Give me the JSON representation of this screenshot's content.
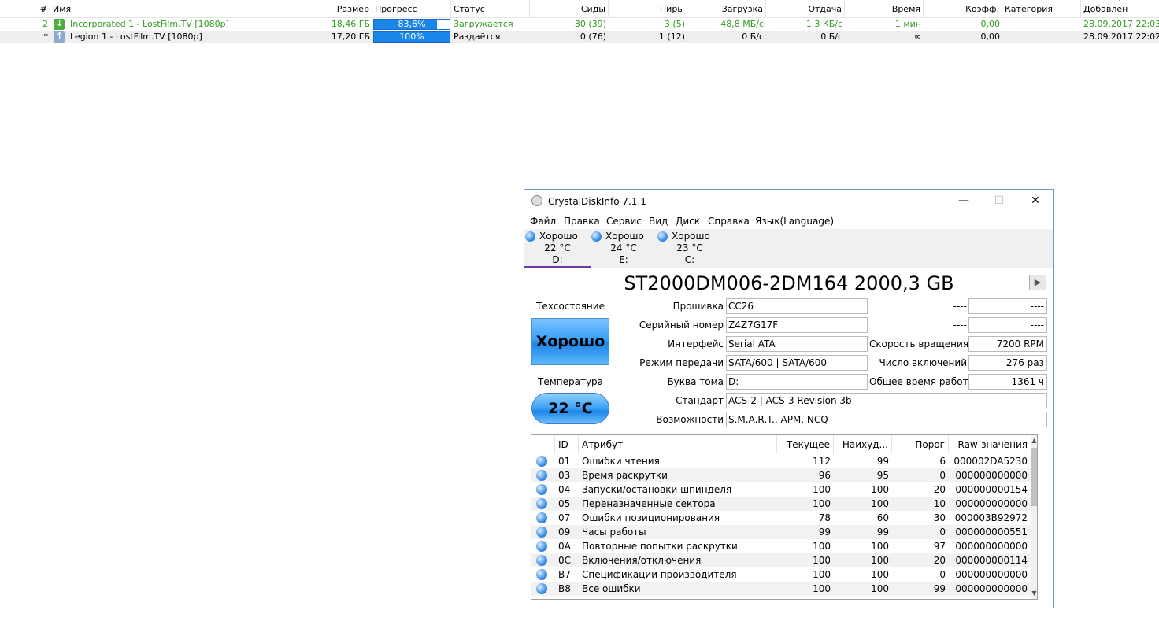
{
  "torrents": {
    "headers": {
      "num": "#",
      "name": "Имя",
      "size": "Размер",
      "progress": "Прогресс",
      "status": "Статус",
      "seeds": "Сиды",
      "peers": "Пиры",
      "down": "Загрузка",
      "up": "Отдача",
      "eta": "Время",
      "ratio": "Коэфф.",
      "category": "Категория",
      "added": "Добавлен"
    },
    "rows": [
      {
        "num": "2",
        "name": "Incorporated 1 - LostFilm.TV [1080p]",
        "size": "18,46 ГБ",
        "progress_text": "83,6%",
        "progress_value": 0.836,
        "status": "Загружается",
        "seeds": "30 (39)",
        "peers": "3 (5)",
        "down": "48,8 МБ/с",
        "up": "1,3 КБ/с",
        "eta": "1 мин",
        "ratio": "0,00",
        "category": "",
        "added": "28.09.2017 22:03",
        "icon": "download-arrow-icon"
      },
      {
        "num": "*",
        "name": "Legion 1 - LostFilm.TV [1080p]",
        "size": "17,20 ГБ",
        "progress_text": "100%",
        "progress_value": 1.0,
        "status": "Раздаётся",
        "seeds": "0 (76)",
        "peers": "1 (12)",
        "down": "0 Б/с",
        "up": "0 Б/с",
        "eta": "∞",
        "ratio": "0,00",
        "category": "",
        "added": "28.09.2017 22:02",
        "icon": "seeding-icon"
      }
    ]
  },
  "cdi": {
    "title": "CrystalDiskInfo 7.1.1",
    "window_buttons": {
      "minimize": "—",
      "maximize": "☐",
      "close": "✕"
    },
    "menu": [
      "Файл",
      "Правка",
      "Сервис",
      "Вид",
      "Диск",
      "Справка",
      "Язык(Language)"
    ],
    "drives": [
      {
        "status": "Хорошо",
        "temp": "22 °C",
        "letter": "D:"
      },
      {
        "status": "Хорошо",
        "temp": "24 °C",
        "letter": "E:"
      },
      {
        "status": "Хорошо",
        "temp": "23 °C",
        "letter": "C:"
      }
    ],
    "model": "ST2000DM006-2DM164 2000,3 GB",
    "health_label": "Техсостояние",
    "health_value": "Хорошо",
    "temp_label": "Температура",
    "temp_value": "22 °C",
    "info": {
      "firmware_label": "Прошивка",
      "firmware": "CC26",
      "serial_label": "Серийный номер",
      "serial": "Z4Z7G17F",
      "interface_label": "Интерфейс",
      "interface": "Serial ATA",
      "transfer_label": "Режим передачи",
      "transfer": "SATA/600 | SATA/600",
      "letter_label": "Буква тома",
      "letter": "D:",
      "standard_label": "Стандарт",
      "standard": "ACS-2 | ACS-3 Revision 3b",
      "features_label": "Возможности",
      "features": "S.M.A.R.T., APM, NCQ",
      "blank1_label": "----",
      "blank1": "----",
      "blank2_label": "----",
      "blank2": "----",
      "rpm_label": "Скорость вращения",
      "rpm": "7200 RPM",
      "power_count_label": "Число включений",
      "power_count": "276 раз",
      "power_hours_label": "Общее время работы",
      "power_hours": "1361 ч"
    },
    "smart_headers": {
      "id": "ID",
      "attr": "Атрибут",
      "current": "Текущее",
      "worst": "Наихуд...",
      "threshold": "Порог",
      "raw": "Raw-значения"
    },
    "smart_rows": [
      {
        "id": "01",
        "attr": "Ошибки чтения",
        "current": "112",
        "worst": "99",
        "threshold": "6",
        "raw": "000002DA5230"
      },
      {
        "id": "03",
        "attr": "Время раскрутки",
        "current": "96",
        "worst": "95",
        "threshold": "0",
        "raw": "000000000000"
      },
      {
        "id": "04",
        "attr": "Запуски/остановки шпинделя",
        "current": "100",
        "worst": "100",
        "threshold": "20",
        "raw": "000000000154"
      },
      {
        "id": "05",
        "attr": "Переназначенные сектора",
        "current": "100",
        "worst": "100",
        "threshold": "10",
        "raw": "000000000000"
      },
      {
        "id": "07",
        "attr": "Ошибки позиционирования",
        "current": "78",
        "worst": "60",
        "threshold": "30",
        "raw": "000003B92972"
      },
      {
        "id": "09",
        "attr": "Часы работы",
        "current": "99",
        "worst": "99",
        "threshold": "0",
        "raw": "000000000551"
      },
      {
        "id": "0A",
        "attr": "Повторные попытки раскрутки",
        "current": "100",
        "worst": "100",
        "threshold": "97",
        "raw": "000000000000"
      },
      {
        "id": "0C",
        "attr": "Включения/отключения",
        "current": "100",
        "worst": "100",
        "threshold": "20",
        "raw": "000000000114"
      },
      {
        "id": "B7",
        "attr": "Спецификации производителя",
        "current": "100",
        "worst": "100",
        "threshold": "0",
        "raw": "000000000000"
      },
      {
        "id": "B8",
        "attr": "Все ошибки",
        "current": "100",
        "worst": "100",
        "threshold": "99",
        "raw": "000000000000"
      }
    ]
  }
}
